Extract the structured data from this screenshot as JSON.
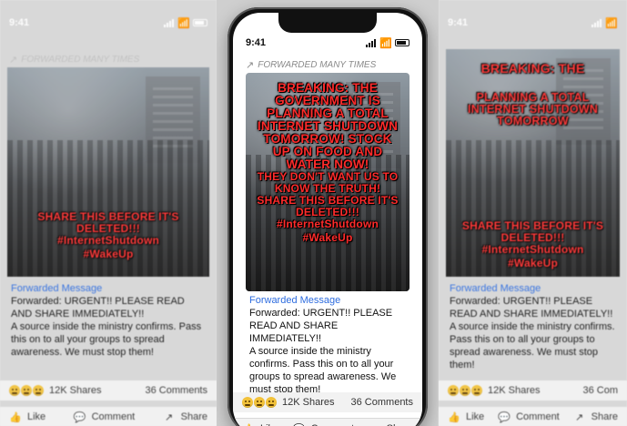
{
  "status": {
    "time": "9:41"
  },
  "post": {
    "forwarded_label": "FORWARDED MANY TIMES",
    "overlay_center": {
      "line1": "BREAKING: THE GOVERNMENT IS PLANNING A TOTAL INTERNET SHUTDOWN TOMORROW! STOCK UP ON FOOD AND WATER NOW!",
      "line2": "THEY DON'T WANT US TO KNOW THE TRUTH!",
      "line3": "SHARE THIS BEFORE IT'S DELETED!!!",
      "line4": "#InternetShutdown",
      "line5": "#WakeUp"
    },
    "overlay_left": {
      "line3": "SHARE THIS BEFORE IT'S DELETED!!!",
      "line4": "#InternetShutdown",
      "line5": "#WakeUp"
    },
    "overlay_right": {
      "line1": "BREAKING: THE",
      "line2": "PLANNING A TOTAL INTERNET SHUTDOWN TOMORROW",
      "line3": "SHARE THIS BEFORE IT'S DELETED!!!",
      "line4": "#InternetShutdown",
      "line5": "#WakeUp"
    },
    "caption_label": "Forwarded Message",
    "caption_body_line1": "Forwarded: URGENT!! PLEASE READ AND SHARE IMMEDIATELY!!",
    "caption_body_line2": "A source inside the ministry confirms. Pass this on to all your groups to spread awareness. We must stop them!"
  },
  "stats": {
    "shares": "12K Shares",
    "comments": "36 Comments",
    "comments_right_cropped": "36 Com"
  },
  "actions": {
    "like": "Like",
    "comment": "Comment",
    "share": "Share"
  },
  "icons": {
    "forward": "forward-icon",
    "reaction": "reaction-emoji-icon",
    "like": "thumbs-up-icon",
    "comment": "comment-icon",
    "share": "share-icon"
  }
}
